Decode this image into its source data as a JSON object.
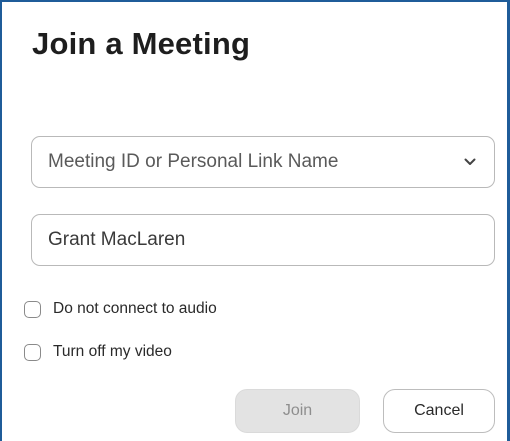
{
  "dialog": {
    "title": "Join a Meeting"
  },
  "meeting_id": {
    "placeholder": "Meeting ID or Personal Link Name",
    "value": "",
    "dropdown_icon": "chevron-down-icon"
  },
  "name_field": {
    "value": "Grant MacLaren"
  },
  "options": [
    {
      "label": "Do not connect to audio",
      "checked": false
    },
    {
      "label": "Turn off my video",
      "checked": false
    }
  ],
  "buttons": {
    "join_label": "Join",
    "join_enabled": false,
    "cancel_label": "Cancel"
  },
  "colors": {
    "frame_border": "#1f5c99",
    "join_disabled_bg": "#e3e3e3",
    "join_disabled_text": "#8e8e8e"
  }
}
